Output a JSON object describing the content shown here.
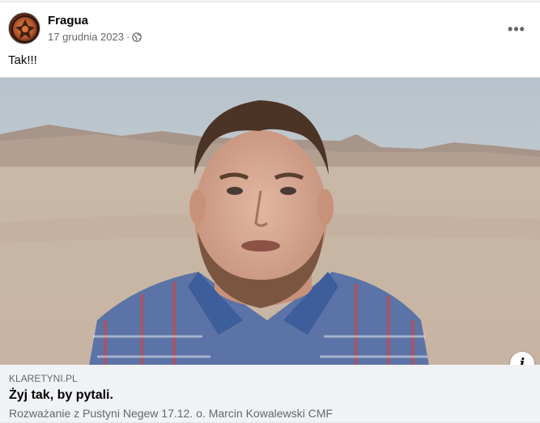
{
  "post": {
    "author": "Fragua",
    "date": "17 grudnia 2023",
    "separator": "·",
    "privacy_icon": "globe-icon",
    "more_label": "•••",
    "text": "Tak!!!"
  },
  "media": {
    "info_label": "i"
  },
  "link": {
    "domain": "KLARETYNI.PL",
    "title": "Żyj tak, by pytali.",
    "description": "Rozważanie z Pustyni Negew 17.12. o. Marcin Kowalewski CMF"
  },
  "colors": {
    "secondary_text": "#65676b",
    "card_background": "#f0f2f5"
  }
}
